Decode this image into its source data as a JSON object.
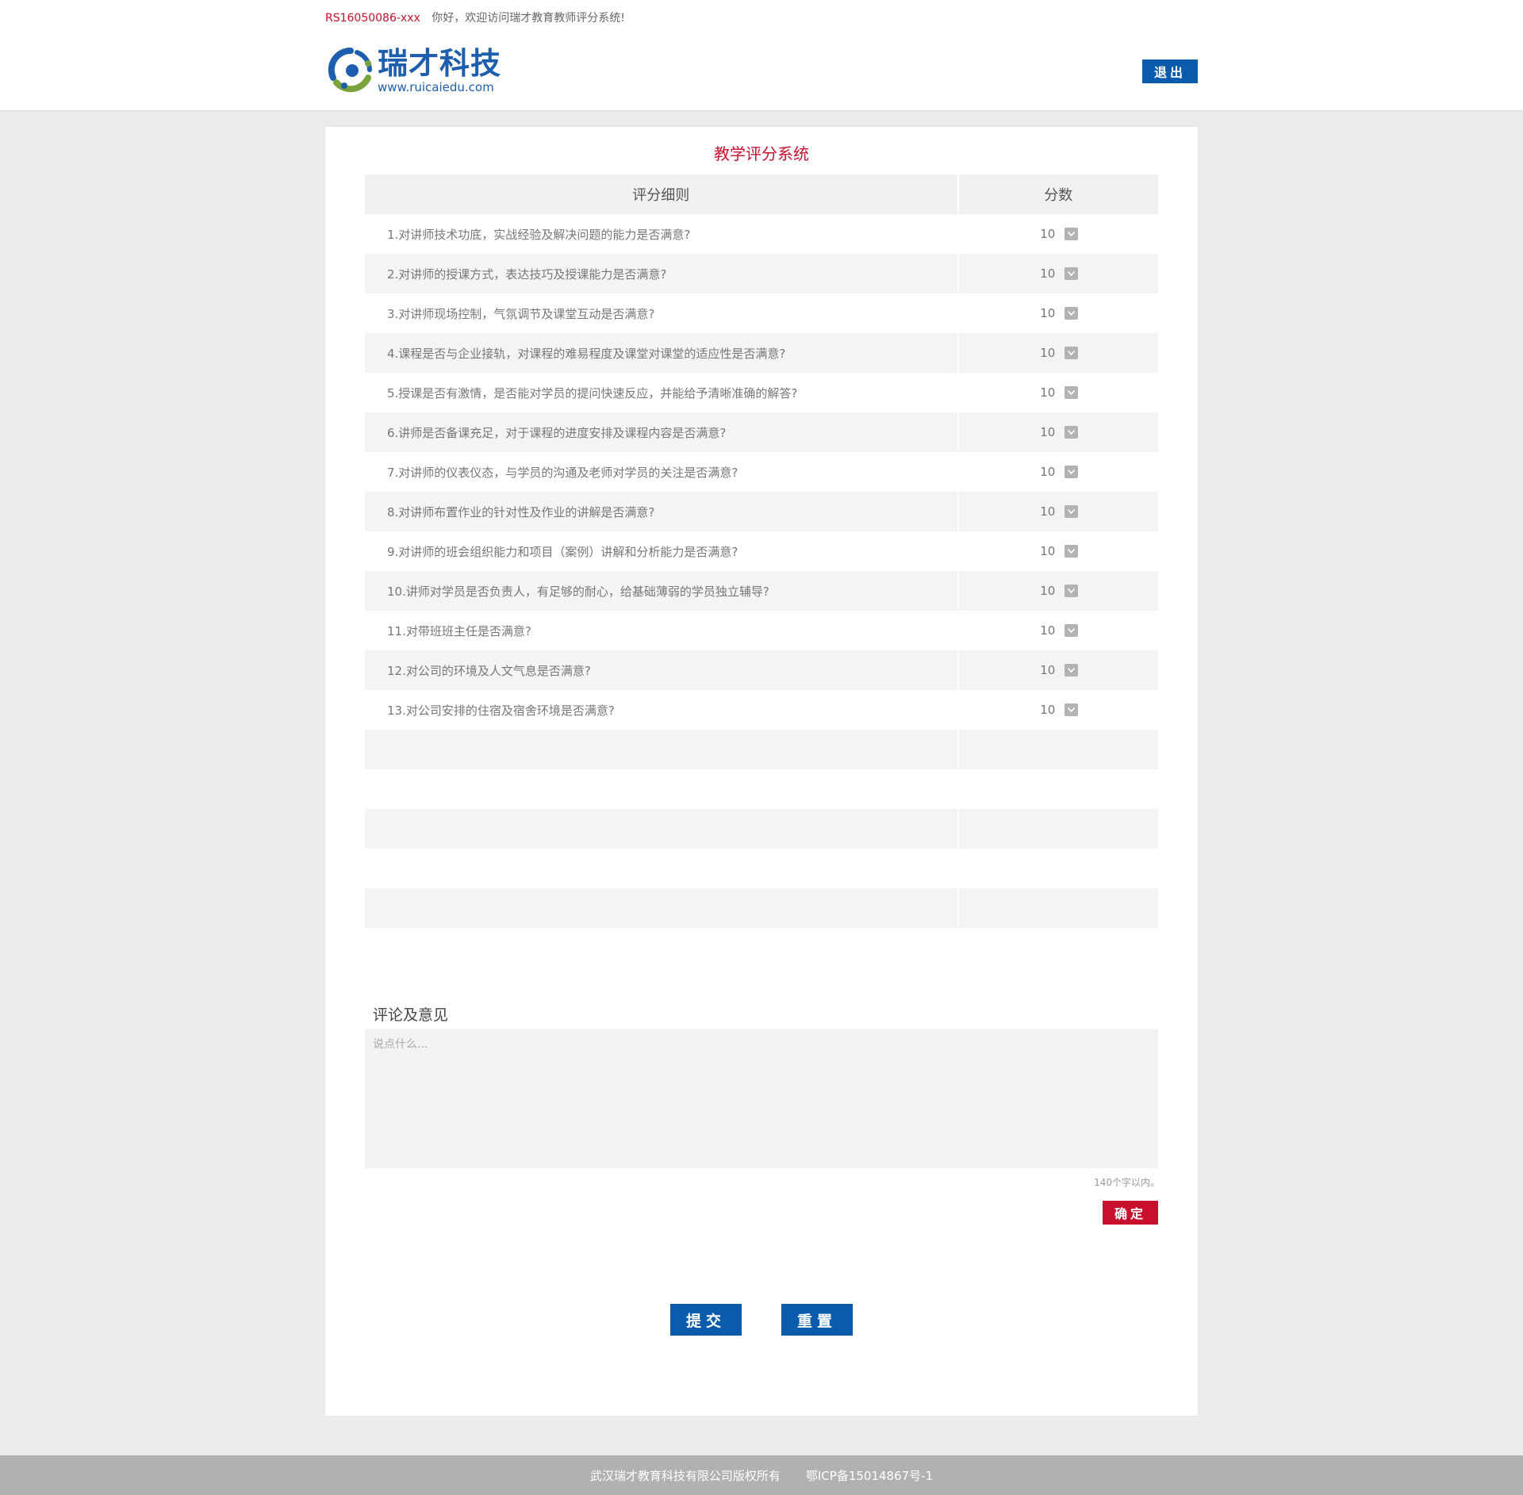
{
  "header": {
    "user_id": "RS16050086-xxx",
    "welcome": "你好，欢迎访问瑞才教育教师评分系统!",
    "logo_cn": "瑞才科技",
    "logo_url": "www.ruicaiedu.com",
    "logout_label": "退出"
  },
  "main": {
    "title": "教学评分系统",
    "table": {
      "col_criteria": "评分细则",
      "col_score": "分数",
      "rows": [
        {
          "text": "1.对讲师技术功底，实战经验及解决问题的能力是否满意?",
          "score": "10"
        },
        {
          "text": "2.对讲师的授课方式，表达技巧及授课能力是否满意?",
          "score": "10"
        },
        {
          "text": "3.对讲师现场控制，气氛调节及课堂互动是否满意?",
          "score": "10"
        },
        {
          "text": "4.课程是否与企业接轨，对课程的难易程度及课堂对课堂的适应性是否满意?",
          "score": "10"
        },
        {
          "text": "5.授课是否有激情，是否能对学员的提问快速反应，并能给予清晰准确的解答?",
          "score": "10"
        },
        {
          "text": "6.讲师是否备课充足，对于课程的进度安排及课程内容是否满意?",
          "score": "10"
        },
        {
          "text": "7.对讲师的仪表仪态，与学员的沟通及老师对学员的关注是否满意?",
          "score": "10"
        },
        {
          "text": "8.对讲师布置作业的针对性及作业的讲解是否满意?",
          "score": "10"
        },
        {
          "text": "9.对讲师的班会组织能力和项目（案例）讲解和分析能力是否满意?",
          "score": "10"
        },
        {
          "text": "10.讲师对学员是否负责人，有足够的耐心，给基础薄弱的学员独立辅导?",
          "score": "10"
        },
        {
          "text": "11.对带班班主任是否满意?",
          "score": "10"
        },
        {
          "text": "12.对公司的环境及人文气息是否满意?",
          "score": "10"
        },
        {
          "text": "13.对公司安排的住宿及宿舍环境是否满意?",
          "score": "10"
        }
      ],
      "empty_rows": 5
    },
    "comment": {
      "label": "评论及意见",
      "placeholder": "说点什么...",
      "value": "",
      "limit_note": "140个字以内。",
      "confirm_label": "确定"
    },
    "submit_label": "提交",
    "reset_label": "重置"
  },
  "footer": {
    "copyright": "武汉瑞才教育科技有限公司版权所有",
    "icp": "鄂ICP备15014867号-1"
  },
  "colors": {
    "brand_blue": "#0b5bac",
    "accent_red": "#c8102e",
    "logo_green": "#7aa33b"
  }
}
